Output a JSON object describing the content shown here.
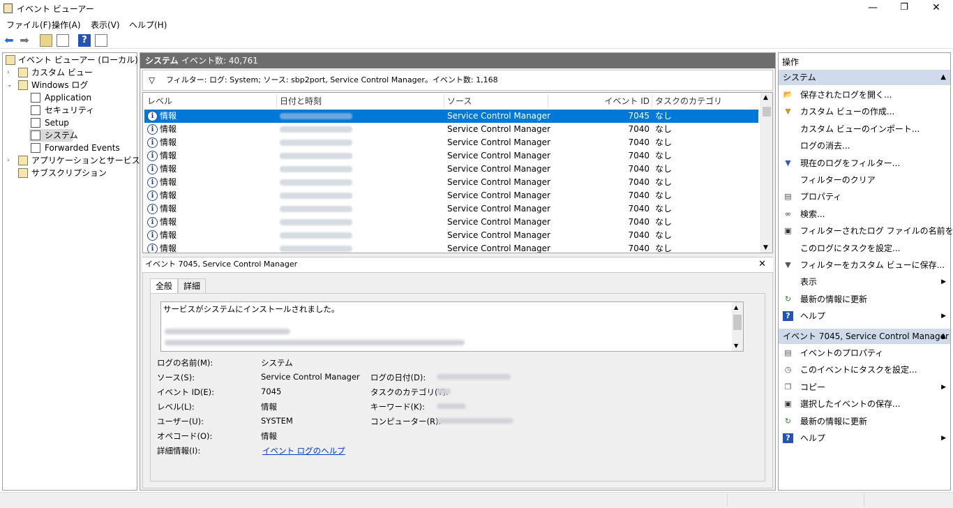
{
  "window": {
    "title": "イベント ビューアー",
    "controls": {
      "minimize": "—",
      "maximize": "❐",
      "close": "✕"
    }
  },
  "menu": [
    "ファイル(F)",
    "操作(A)",
    "表示(V)",
    "ヘルプ(H)"
  ],
  "tree": {
    "root": "イベント ビューアー (ローカル)",
    "custom_views": "カスタム ビュー",
    "windows_logs": "Windows ログ",
    "logs": [
      "Application",
      "セキュリティ",
      "Setup",
      "システム",
      "Forwarded Events"
    ],
    "app_service_logs": "アプリケーションとサービス ログ",
    "subscriptions": "サブスクリプション"
  },
  "center": {
    "log_name": "システム",
    "event_count": "イベント数: 40,761",
    "filter_text": "フィルター: ログ: System; ソース: sbp2port, Service Control Manager。イベント数: 1,168",
    "columns": [
      "レベル",
      "日付と時刻",
      "ソース",
      "イベント ID",
      "タスクのカテゴリ"
    ],
    "rows": [
      {
        "level": "情報",
        "source": "Service Control Manager",
        "id": "7045",
        "category": "なし"
      },
      {
        "level": "情報",
        "source": "Service Control Manager",
        "id": "7040",
        "category": "なし"
      },
      {
        "level": "情報",
        "source": "Service Control Manager",
        "id": "7040",
        "category": "なし"
      },
      {
        "level": "情報",
        "source": "Service Control Manager",
        "id": "7040",
        "category": "なし"
      },
      {
        "level": "情報",
        "source": "Service Control Manager",
        "id": "7040",
        "category": "なし"
      },
      {
        "level": "情報",
        "source": "Service Control Manager",
        "id": "7040",
        "category": "なし"
      },
      {
        "level": "情報",
        "source": "Service Control Manager",
        "id": "7040",
        "category": "なし"
      },
      {
        "level": "情報",
        "source": "Service Control Manager",
        "id": "7040",
        "category": "なし"
      },
      {
        "level": "情報",
        "source": "Service Control Manager",
        "id": "7040",
        "category": "なし"
      },
      {
        "level": "情報",
        "source": "Service Control Manager",
        "id": "7040",
        "category": "なし"
      },
      {
        "level": "情報",
        "source": "Service Control Manager",
        "id": "7040",
        "category": "なし"
      }
    ]
  },
  "detail": {
    "title": "イベント 7045, Service Control Manager",
    "tabs": [
      "全般",
      "詳細"
    ],
    "message": "サービスがシステムにインストールされました。",
    "fields": {
      "log_name_label": "ログの名前(M):",
      "log_name_value": "システム",
      "source_label": "ソース(S):",
      "source_value": "Service Control Manager",
      "date_label": "ログの日付(D):",
      "event_id_label": "イベント ID(E):",
      "event_id_value": "7045",
      "task_category_label": "タスクのカテゴリ(Y):",
      "level_label": "レベル(L):",
      "level_value": "情報",
      "keywords_label": "キーワード(K):",
      "user_label": "ユーザー(U):",
      "user_value": "SYSTEM",
      "computer_label": "コンピューター(R):",
      "opcode_label": "オペコード(O):",
      "opcode_value": "情報",
      "more_info_label": "詳細情報(I):",
      "more_info_link": "イベント ログのヘルプ"
    }
  },
  "actions": {
    "header": "操作",
    "section1": "システム",
    "items1": [
      {
        "label": "保存されたログを開く...",
        "icon": "folder-open-icon",
        "submenu": false
      },
      {
        "label": "カスタム ビューの作成...",
        "icon": "filter-create-icon",
        "submenu": false
      },
      {
        "label": "カスタム ビューのインポート...",
        "icon": "",
        "submenu": false
      },
      {
        "label": "ログの消去...",
        "icon": "",
        "submenu": false
      },
      {
        "label": "現在のログをフィルター...",
        "icon": "filter-icon",
        "submenu": false
      },
      {
        "label": "フィルターのクリア",
        "icon": "",
        "submenu": false
      },
      {
        "label": "プロパティ",
        "icon": "properties-icon",
        "submenu": false
      },
      {
        "label": "検索...",
        "icon": "binoculars-icon",
        "submenu": false
      },
      {
        "label": "フィルターされたログ ファイルの名前を付...",
        "icon": "save-icon",
        "submenu": false
      },
      {
        "label": "このログにタスクを設定...",
        "icon": "",
        "submenu": false
      },
      {
        "label": "フィルターをカスタム ビューに保存...",
        "icon": "filter-save-icon",
        "submenu": false
      },
      {
        "label": "表示",
        "icon": "",
        "submenu": true
      },
      {
        "label": "最新の情報に更新",
        "icon": "refresh-icon",
        "submenu": false
      },
      {
        "label": "ヘルプ",
        "icon": "help-icon",
        "submenu": true
      }
    ],
    "section2": "イベント 7045, Service Control Manager",
    "items2": [
      {
        "label": "イベントのプロパティ",
        "icon": "properties-icon",
        "submenu": false
      },
      {
        "label": "このイベントにタスクを設定...",
        "icon": "task-icon",
        "submenu": false
      },
      {
        "label": "コピー",
        "icon": "copy-icon",
        "submenu": true
      },
      {
        "label": "選択したイベントの保存...",
        "icon": "save-icon",
        "submenu": false
      },
      {
        "label": "最新の情報に更新",
        "icon": "refresh-icon",
        "submenu": false
      },
      {
        "label": "ヘルプ",
        "icon": "help-icon",
        "submenu": true
      }
    ]
  },
  "colors": {
    "selection": "#0078d7",
    "panel_header": "#6d6d6d",
    "action_header": "#cfdbea",
    "link": "#0033cc"
  }
}
